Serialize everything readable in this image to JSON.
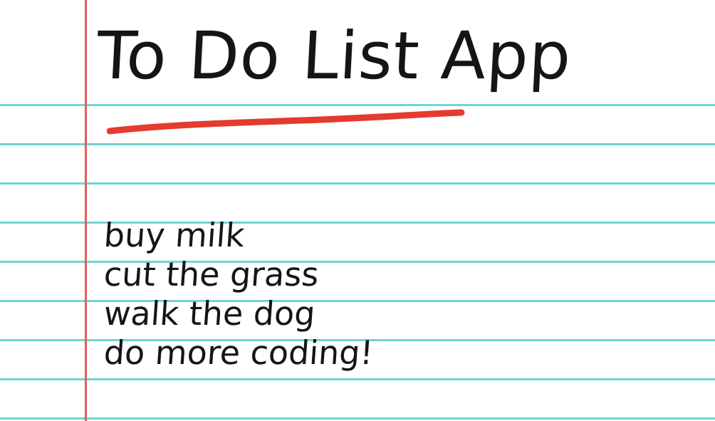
{
  "page": {
    "title": "To Do List App",
    "accent_underline_color": "#e53a2e",
    "rule_color": "#6fd6cf",
    "margin_color": "#e85a5a",
    "text_color": "#151515"
  },
  "todos": {
    "items": [
      {
        "label": "buy milk"
      },
      {
        "label": "cut the grass"
      },
      {
        "label": "walk the dog"
      },
      {
        "label": "do more coding!"
      }
    ]
  }
}
